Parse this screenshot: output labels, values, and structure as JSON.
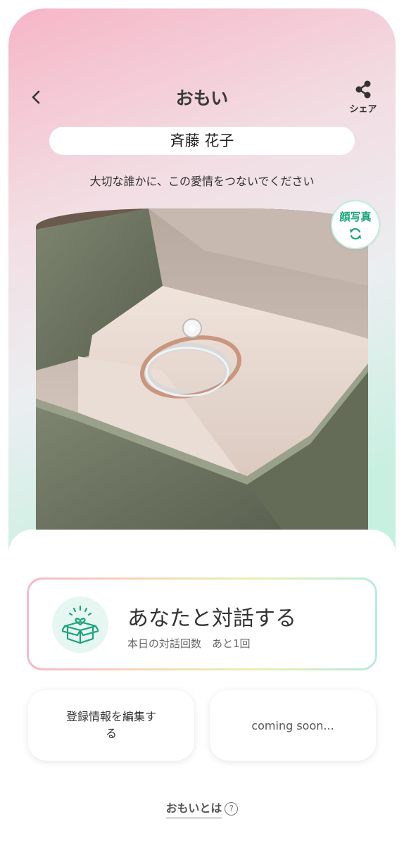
{
  "header": {
    "title": "おもい",
    "share_label": "シェア"
  },
  "profile": {
    "name": "斉藤 花子",
    "subtitle": "大切な誰かに、この愛情をつないでください"
  },
  "photo": {
    "face_button_label": "顔写真"
  },
  "chat": {
    "title": "あなたと対話する",
    "sub": "本日の対話回数　あと1回"
  },
  "cards": {
    "edit_label": "登録情報を編集する",
    "coming_label": "coming soon..."
  },
  "footer": {
    "about_label": "おもいとは",
    "help_symbol": "?"
  },
  "colors": {
    "accent_green": "#1aa478",
    "gradient_pink": "#f6b6c7",
    "gradient_mint": "#bdf0de"
  }
}
